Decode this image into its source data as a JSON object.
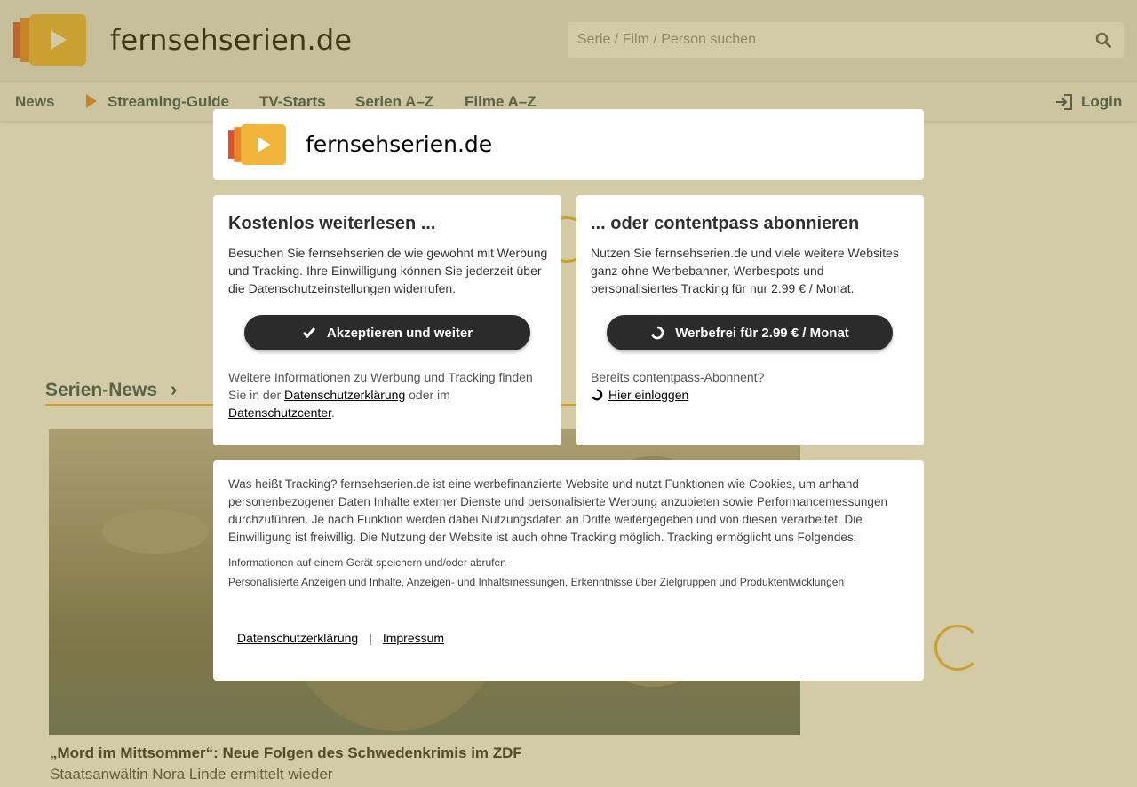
{
  "site": {
    "logo_text": "fernsehserien.de",
    "search_placeholder": "Serie / Film / Person suchen"
  },
  "nav": {
    "items": [
      "News",
      "Streaming-Guide",
      "TV-Starts",
      "Serien A–Z",
      "Filme A–Z"
    ],
    "login_label": "Login"
  },
  "content": {
    "section_title": "Serien-News",
    "section_chevron": "›",
    "headline": "„Mord im Mittsommer“: Neue Folgen des Schwedenkrimis im ZDF",
    "subline": "Staatsanwältin Nora Linde ermittelt wieder"
  },
  "dialog": {
    "logo_text": "fernsehserien.de",
    "left": {
      "title": "Kostenlos weiterlesen ...",
      "text": "Besuchen Sie fernsehserien.de wie gewohnt mit Werbung und Tracking. Ihre Einwilligung können Sie jederzeit über die Datenschutzeinstellungen widerrufen.",
      "button_label": "Akzeptieren und weiter",
      "info_prefix": "Weitere Informationen zu Werbung und Tracking finden Sie in der ",
      "link_privacy": "Datenschutzerklärung",
      "info_middle": " oder im ",
      "link_center": "Datenschutzcenter",
      "info_suffix": "."
    },
    "right": {
      "title": "... oder contentpass abonnieren",
      "text": "Nutzen Sie fernsehserien.de und viele weitere Websites ganz ohne Werbebanner, Werbespots und personalisiertes Tracking für nur 2.99 € / Monat.",
      "button_label": "Werbefrei für 2.99 € / Monat",
      "already_label": "Bereits contentpass-Abonnent?",
      "login_link": "Hier einloggen"
    },
    "tracking": {
      "text": "Was heißt Tracking? fernsehserien.de ist eine werbefinanzierte Website und nutzt Funktionen wie Cookies, um anhand personenbezogener Daten Inhalte externer Dienste und personalisierte Werbung anzubieten sowie Performancemessungen durchzuführen. Je nach Funktion werden dabei Nutzungsdaten an Dritte weitergegeben und von diesen verarbeitet. Die Einwilligung ist freiwillig. Die Nutzung der Website ist auch ohne Tracking möglich. Tracking ermöglicht uns Folgendes:",
      "purposes": [
        "Informationen auf einem Gerät speichern und/oder abrufen",
        "Personalisierte Anzeigen und Inhalte, Anzeigen- und Inhaltsmessungen, Erkenntnisse über Zielgruppen und Produktentwicklungen"
      ]
    },
    "footer": {
      "privacy": "Datenschutzerklärung",
      "separator": "|",
      "imprint": "Impressum"
    }
  },
  "colors": {
    "accent": "#f0b53a",
    "logo_orange": "#e8862a",
    "logo_red": "#d9532b",
    "nav_text": "#2b4b5c",
    "button_bg": "#2b2b2b",
    "overlay": "rgba(150,130,40,0.42)"
  },
  "icons": {
    "search": "search-icon",
    "play": "play-icon",
    "login": "login-icon",
    "check": "check-icon",
    "spinner": "contentpass-icon"
  }
}
